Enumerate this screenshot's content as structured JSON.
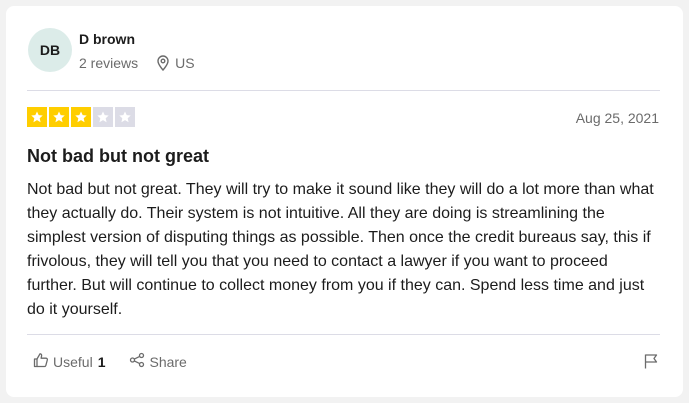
{
  "reviewer": {
    "initials": "DB",
    "name": "D brown",
    "reviews": "2 reviews",
    "country": "US"
  },
  "review": {
    "rating": 3,
    "max_rating": 5,
    "date": "Aug 25, 2021",
    "title": "Not bad but not great",
    "body": "Not bad but not great. They will try to make it sound like they will do a lot more than what they actually do. Their system is not intuitive. All they are doing is streamlining the simplest version of disputing things as possible. Then once the credit bureaus say, this if frivolous, they will tell you that you need to contact a lawyer if you want to proceed further. But will continue to collect money from you if they can. Spend less time and just do it yourself."
  },
  "actions": {
    "useful_label": "Useful",
    "useful_count": "1",
    "share_label": "Share"
  },
  "colors": {
    "star_on": "#ffce00",
    "star_off": "#dcdce6",
    "avatar_bg": "#dcece9"
  },
  "icons": [
    "location-pin-icon",
    "star-icon",
    "thumbs-up-icon",
    "share-icon",
    "flag-icon"
  ]
}
